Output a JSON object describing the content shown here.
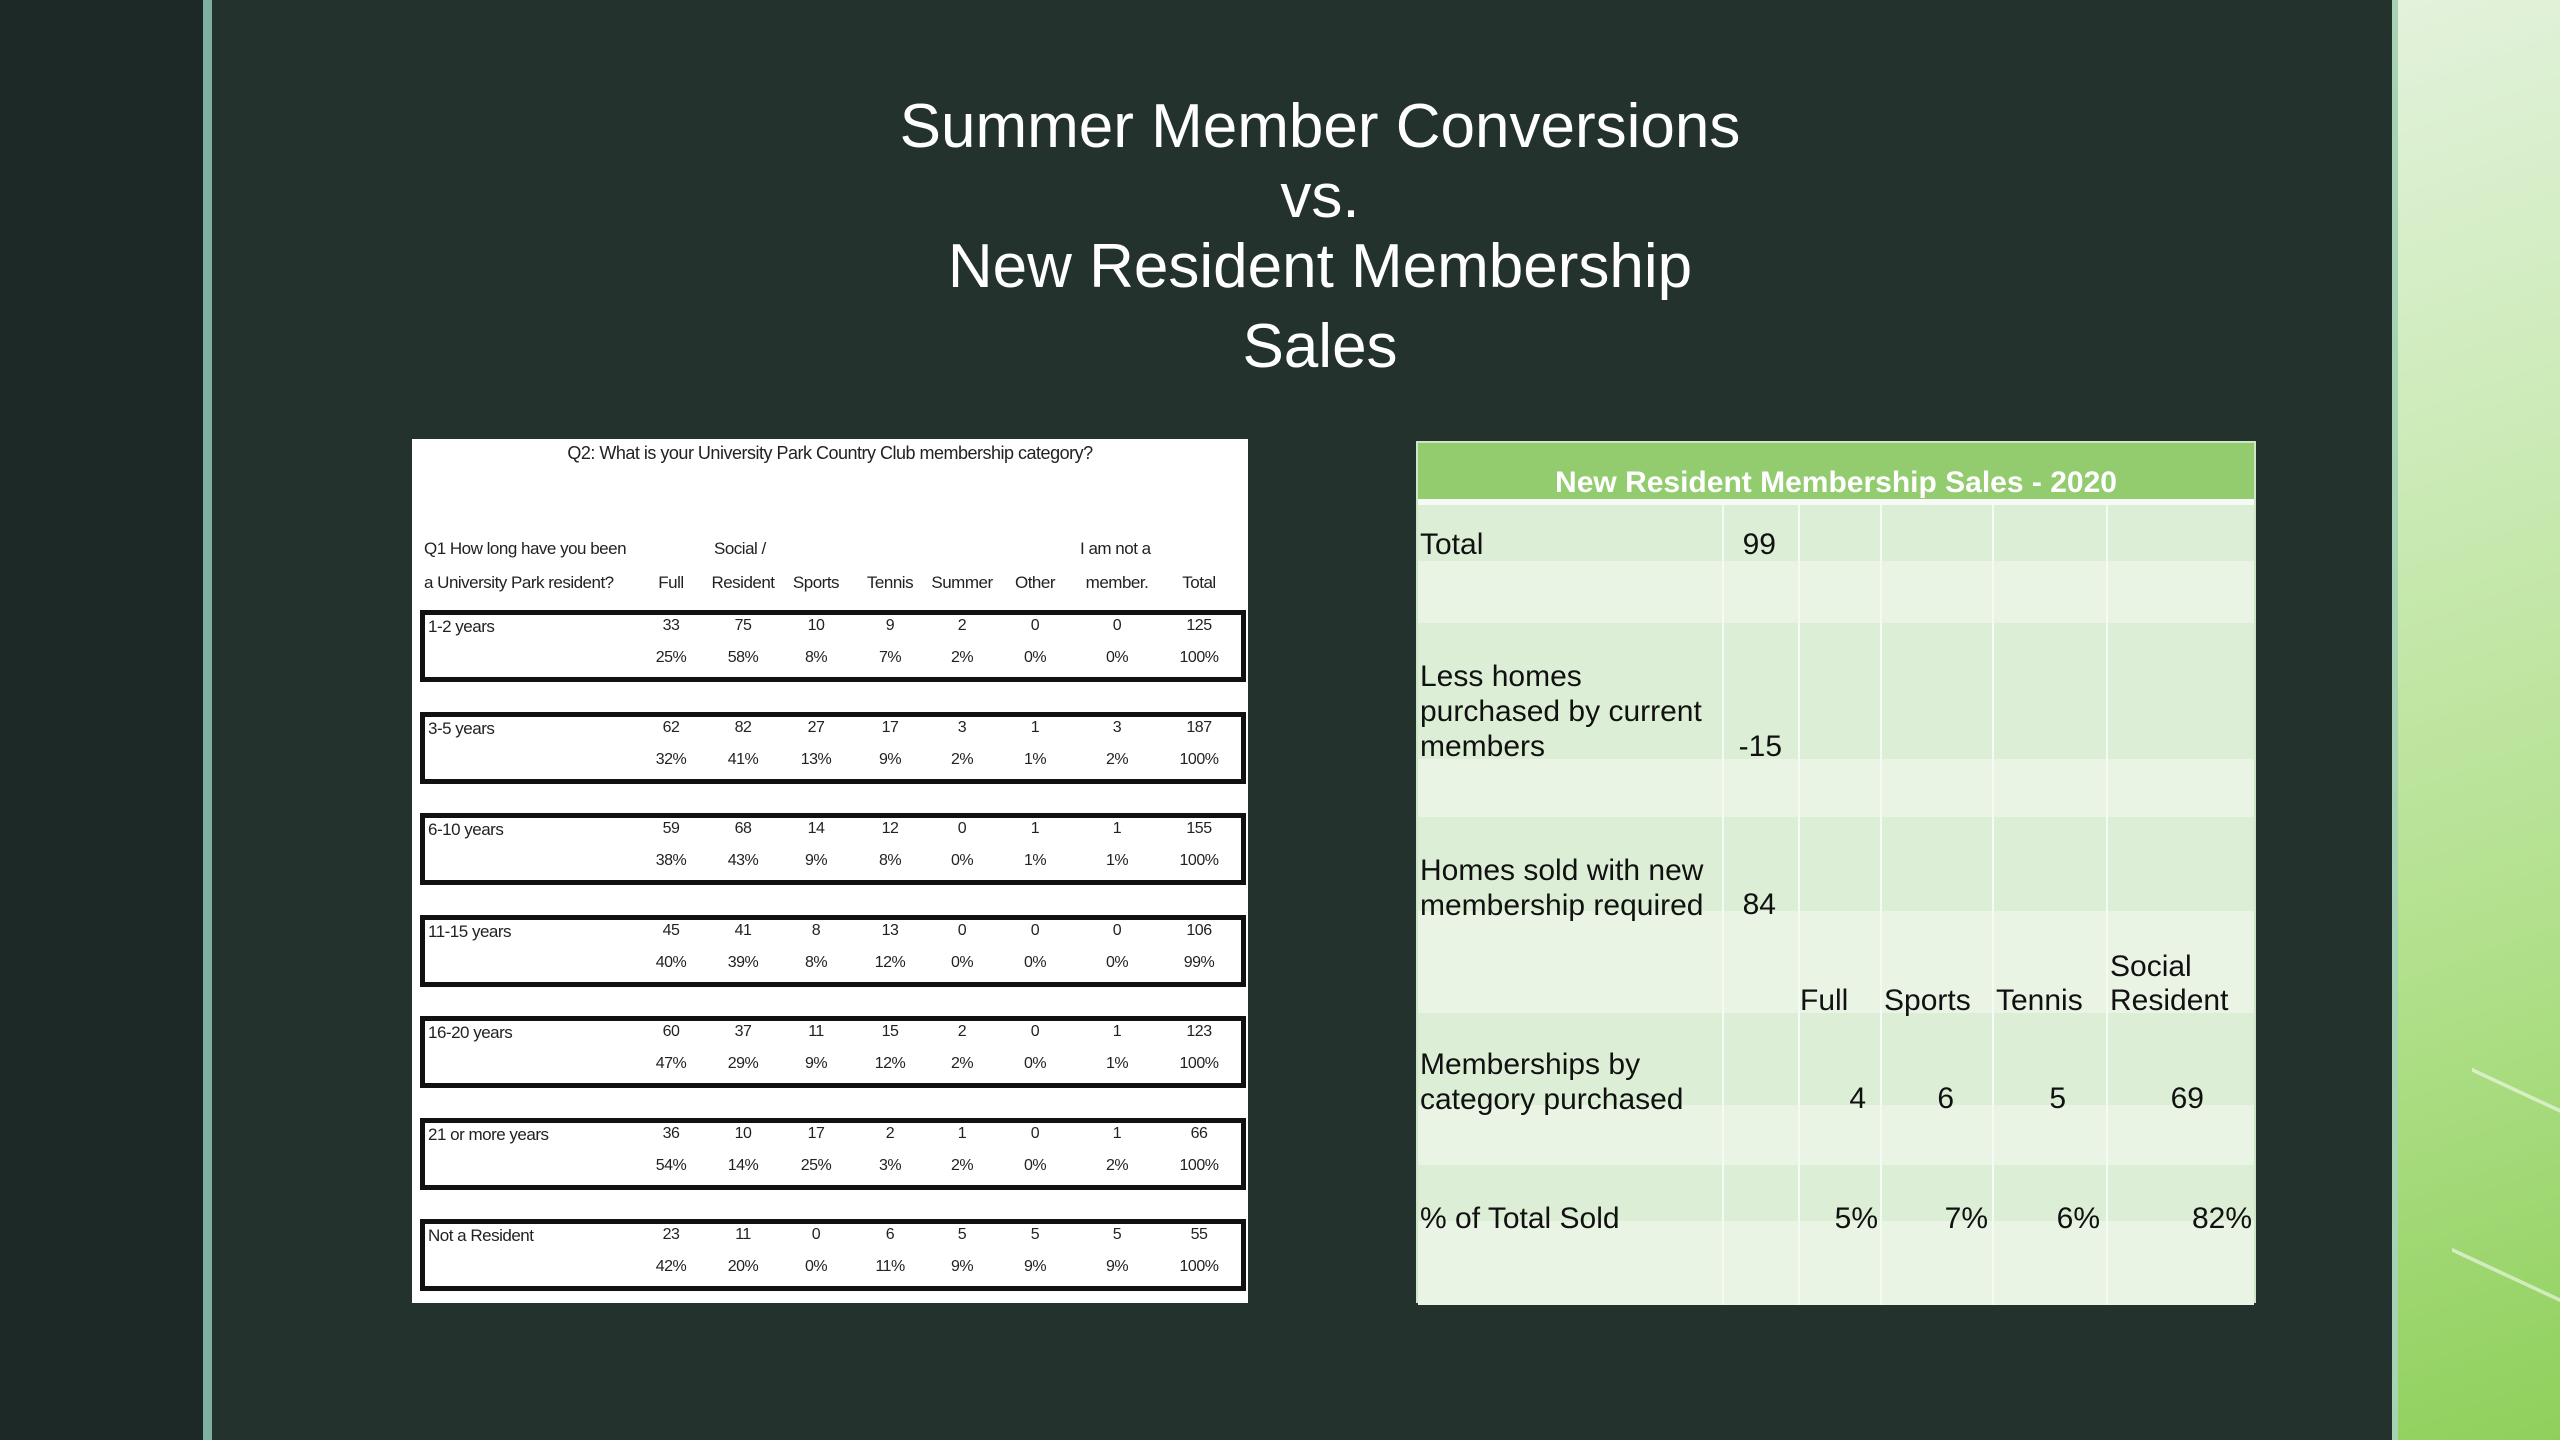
{
  "slide": {
    "title_lines": [
      "Summer Member Conversions",
      "vs.",
      "New Resident Membership",
      "Sales"
    ]
  },
  "survey": {
    "question": "Q2: What is your University Park Country Club membership category?",
    "q1_line1": "Q1 How long have you been",
    "q1_line2": "a University Park resident?",
    "headers_top": {
      "social": "Social /",
      "not_member": "I am not a"
    },
    "headers": [
      "Full",
      "Resident",
      "Sports",
      "Tennis",
      "Summer",
      "Other",
      "member.",
      "Total"
    ],
    "rows": [
      {
        "label": "1-2 years",
        "counts": [
          "33",
          "75",
          "10",
          "9",
          "2",
          "0",
          "0",
          "125"
        ],
        "pcts": [
          "25%",
          "58%",
          "8%",
          "7%",
          "2%",
          "0%",
          "0%",
          "100%"
        ]
      },
      {
        "label": "3-5 years",
        "counts": [
          "62",
          "82",
          "27",
          "17",
          "3",
          "1",
          "3",
          "187"
        ],
        "pcts": [
          "32%",
          "41%",
          "13%",
          "9%",
          "2%",
          "1%",
          "2%",
          "100%"
        ]
      },
      {
        "label": "6-10 years",
        "counts": [
          "59",
          "68",
          "14",
          "12",
          "0",
          "1",
          "1",
          "155"
        ],
        "pcts": [
          "38%",
          "43%",
          "9%",
          "8%",
          "0%",
          "1%",
          "1%",
          "100%"
        ]
      },
      {
        "label": "11-15 years",
        "counts": [
          "45",
          "41",
          "8",
          "13",
          "0",
          "0",
          "0",
          "106"
        ],
        "pcts": [
          "40%",
          "39%",
          "8%",
          "12%",
          "0%",
          "0%",
          "0%",
          "99%"
        ]
      },
      {
        "label": "16-20 years",
        "counts": [
          "60",
          "37",
          "11",
          "15",
          "2",
          "0",
          "1",
          "123"
        ],
        "pcts": [
          "47%",
          "29%",
          "9%",
          "12%",
          "2%",
          "0%",
          "1%",
          "100%"
        ]
      },
      {
        "label": "21 or more years",
        "counts": [
          "36",
          "10",
          "17",
          "2",
          "1",
          "0",
          "1",
          "66"
        ],
        "pcts": [
          "54%",
          "14%",
          "25%",
          "3%",
          "2%",
          "0%",
          "2%",
          "100%"
        ]
      },
      {
        "label": "Not a Resident",
        "counts": [
          "23",
          "11",
          "0",
          "6",
          "5",
          "5",
          "5",
          "55"
        ],
        "pcts": [
          "42%",
          "20%",
          "0%",
          "11%",
          "9%",
          "9%",
          "9%",
          "100%"
        ]
      }
    ]
  },
  "sales": {
    "title": "New Resident Membership Sales - 2020",
    "total_label": "Total",
    "total_value": "99",
    "less_label": [
      "Less homes",
      "purchased by current",
      "members"
    ],
    "less_value": "-15",
    "homes_label": [
      "Homes sold with new",
      "membership required"
    ],
    "homes_value": "84",
    "categories": [
      "Full",
      "Sports",
      "Tennis",
      "Social",
      "Resident"
    ],
    "by_cat_label": [
      "Memberships by",
      "category purchased"
    ],
    "by_cat_values": [
      "4",
      "6",
      "5",
      "69"
    ],
    "pct_label": "% of Total Sold",
    "pct_values": [
      "5%",
      "7%",
      "6%",
      "82%"
    ]
  },
  "colors": {
    "background": "#24322e",
    "accent_line": "#7fb0a2",
    "table_header_green": "#92cc6f",
    "table_body": "#e9f4e4"
  }
}
